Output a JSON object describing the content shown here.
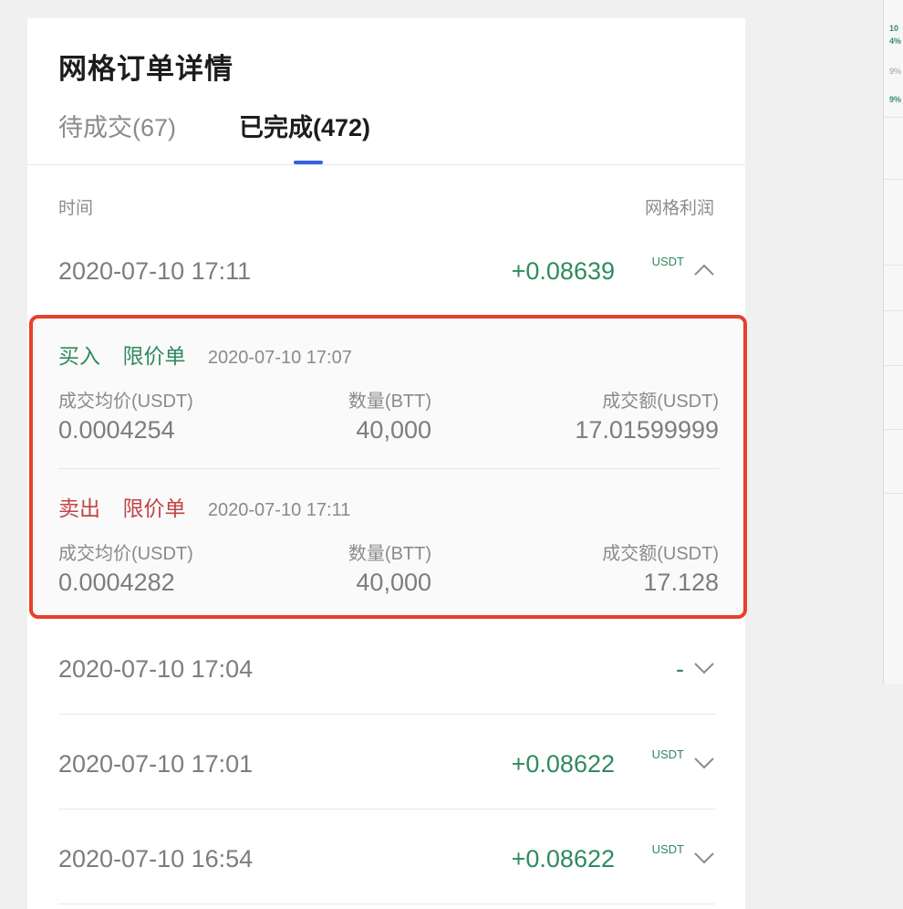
{
  "panel": {
    "title": "网格订单详情"
  },
  "tabs": [
    {
      "label": "待成交(67)",
      "active": false
    },
    {
      "label": "已完成(472)",
      "active": true
    }
  ],
  "columns": {
    "time": "时间",
    "profit": "网格利润"
  },
  "rows": [
    {
      "time": "2020-07-10 17:11",
      "profit": "+0.08639",
      "unit": "USDT",
      "expanded": true
    },
    {
      "time": "2020-07-10 17:04",
      "profit": "-",
      "unit": "",
      "expanded": false
    },
    {
      "time": "2020-07-10 17:01",
      "profit": "+0.08622",
      "unit": "USDT",
      "expanded": false
    },
    {
      "time": "2020-07-10 16:54",
      "profit": "+0.08622",
      "unit": "USDT",
      "expanded": false
    }
  ],
  "detail": {
    "orders": [
      {
        "side": "买入",
        "type": "限价单",
        "date": "2020-07-10 17:07",
        "price_label": "成交均价(USDT)",
        "price": "0.0004254",
        "qty_label": "数量(BTT)",
        "qty": "40,000",
        "amount_label": "成交额(USDT)",
        "amount": "17.01599999"
      },
      {
        "side": "卖出",
        "type": "限价单",
        "date": "2020-07-10 17:11",
        "price_label": "成交均价(USDT)",
        "price": "0.0004282",
        "qty_label": "数量(BTT)",
        "qty": "40,000",
        "amount_label": "成交额(USDT)",
        "amount": "17.128"
      }
    ]
  },
  "colors": {
    "profit_green": "#2f8a5f",
    "sell_red": "#c24444",
    "tab_accent": "#3461e6",
    "highlight_border": "#e8402a"
  },
  "icons": {
    "expanded": "chevron-up-icon",
    "collapsed": "chevron-down-icon"
  }
}
